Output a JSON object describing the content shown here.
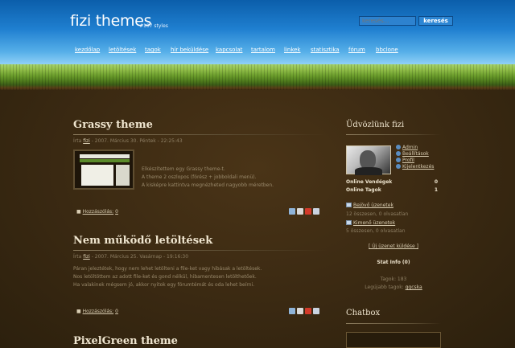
{
  "header": {
    "logo_title": "fizi themes",
    "logo_subtitle": "#107 styles",
    "search_placeholder": "keresés...",
    "search_button": "keresés"
  },
  "nav": [
    {
      "label": "kezdőlap"
    },
    {
      "label": "letöltések"
    },
    {
      "label": "tagok"
    },
    {
      "label": "hír beküldése"
    },
    {
      "label": "kapcsolat"
    },
    {
      "label": "tartalom"
    },
    {
      "label": "linkek"
    },
    {
      "label": "statisztika"
    },
    {
      "label": "fórum"
    },
    {
      "label": "bbclone"
    }
  ],
  "posts": [
    {
      "title": "Grassy theme",
      "meta_prefix": "Írta",
      "author": "fizi",
      "meta_suffix": "- 2007. Március 30. Péntek - 22:25:43",
      "lines": [
        "Elkészítettem egy Grassy theme-t.",
        "A theme 2 oszlopos (fórész + jobboldali menü).",
        "A kisképre kattintva megnézheted nagyobb méretben."
      ],
      "comments_label": "Hozzászólás:",
      "comments_count": "0"
    },
    {
      "title": "Nem működő letöltések",
      "meta_prefix": "Írta",
      "author": "fizi",
      "meta_suffix": "- 2007. Március 25. Vasárnap - 19:16:30",
      "lines": [
        "Páran jeleztétek, hogy nem lehet letölteni a file-ket vagy hibásak a letöltések.",
        "Nos letöltöttem az adott file-ket és gond nélkül, hibamentesen letölthetőek.",
        "Ha valakinek mégsem jó, akkor nyitok egy fórumtémát és oda lehet beírni."
      ],
      "comments_label": "Hozzászólás:",
      "comments_count": "0"
    },
    {
      "title": "PixelGreen theme"
    }
  ],
  "sidebar": {
    "welcome_title": "Üdvözlünk fizi",
    "user_links": [
      "Admin",
      "Beállítások",
      "Profil",
      "Kijelentkezés"
    ],
    "online_visitors_label": "Online Vendégek",
    "online_visitors": "0",
    "online_members_label": "Online Tagok",
    "online_members": "1",
    "inbox_label": "Bejövő üzenetek",
    "inbox_info": "12 összesen, 0 olvasatlan",
    "outbox_label": "Kimenő üzenetek",
    "outbox_info": "5 összesen, 0 olvasatlan",
    "new_message_label": "[ Új üzenet küldése ]",
    "stat_title": "Stat Info (0)",
    "members_line": "Tagok: 183",
    "newest_member_prefix": "Legújabb tagok:",
    "newest_member": "ggcska",
    "chatbox_title": "Chatbox"
  },
  "colors": {
    "sky_top": "#0b5eaa",
    "sky_bottom": "#8fd0f6",
    "grass": "#6a9c2b",
    "soil": "#3a2a12",
    "title_text": "#efe5cf",
    "body_text": "#a6967a"
  }
}
